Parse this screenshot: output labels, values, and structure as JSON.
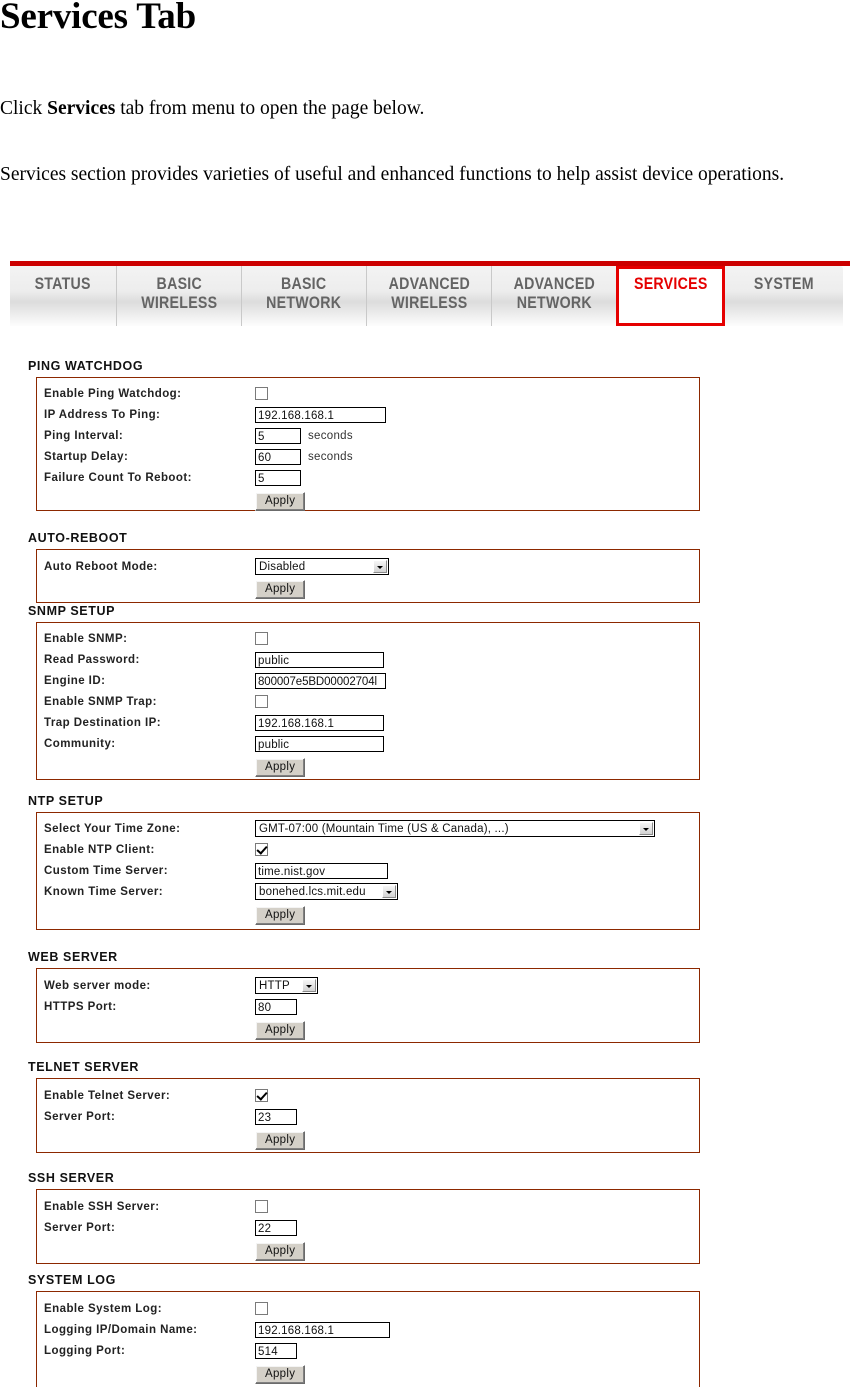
{
  "document": {
    "title": "Services Tab",
    "paragraph_1_pre": "Click ",
    "paragraph_1_bold": "Services",
    "paragraph_1_post": " tab from menu to open the page below.",
    "paragraph_2": "Services section provides varieties of useful and enhanced functions to help assist device operations."
  },
  "colors": {
    "accent_red": "#cc0000",
    "active_tab_red": "#e50000",
    "panel_border": "#8c2800",
    "tab_text": "#646464"
  },
  "navigation": {
    "tabs": [
      {
        "label": "STATUS",
        "active": false
      },
      {
        "label": "BASIC\nWIRELESS",
        "active": false
      },
      {
        "label": "BASIC\nNETWORK",
        "active": false
      },
      {
        "label": "ADVANCED\nWIRELESS",
        "active": false
      },
      {
        "label": "ADVANCED\nNETWORK",
        "active": false
      },
      {
        "label": "SERVICES",
        "active": true
      },
      {
        "label": "SYSTEM",
        "active": false
      }
    ]
  },
  "sections": {
    "ping_watchdog": {
      "title": "PING WATCHDOG",
      "enable_label": "Enable Ping Watchdog:",
      "enable_checked": false,
      "ip_label": "IP Address To Ping:",
      "ip_value": "192.168.168.1",
      "interval_label": "Ping Interval:",
      "interval_value": "5",
      "interval_unit": "seconds",
      "delay_label": "Startup Delay:",
      "delay_value": "60",
      "delay_unit": "seconds",
      "failure_label": "Failure Count To Reboot:",
      "failure_value": "5",
      "apply_label": "Apply"
    },
    "auto_reboot": {
      "title": "AUTO-REBOOT",
      "mode_label": "Auto Reboot Mode:",
      "mode_value": "Disabled",
      "apply_label": "Apply"
    },
    "snmp_setup": {
      "title": "SNMP SETUP",
      "enable_label": "Enable SNMP:",
      "enable_checked": false,
      "read_password_label": "Read Password:",
      "read_password_value": "public",
      "engine_id_label": "Engine ID:",
      "engine_id_value": "800007e5BD00002704l",
      "trap_label": "Enable SNMP Trap:",
      "trap_checked": false,
      "trap_ip_label": "Trap Destination IP:",
      "trap_ip_value": "192.168.168.1",
      "community_label": "Community:",
      "community_value": "public",
      "apply_label": "Apply"
    },
    "ntp_setup": {
      "title": "NTP SETUP",
      "timezone_label": "Select Your Time Zone:",
      "timezone_value": "GMT-07:00 (Mountain Time (US & Canada), ...)",
      "enable_label": "Enable NTP Client:",
      "enable_checked": true,
      "custom_server_label": "Custom Time Server:",
      "custom_server_value": "time.nist.gov",
      "known_server_label": "Known Time Server:",
      "known_server_value": "bonehed.lcs.mit.edu",
      "apply_label": "Apply"
    },
    "web_server": {
      "title": "WEB SERVER",
      "mode_label": "Web server mode:",
      "mode_value": "HTTP",
      "port_label": "HTTPS Port:",
      "port_value": "80",
      "apply_label": "Apply"
    },
    "telnet_server": {
      "title": "TELNET SERVER",
      "enable_label": "Enable Telnet Server:",
      "enable_checked": true,
      "port_label": "Server Port:",
      "port_value": "23",
      "apply_label": "Apply"
    },
    "ssh_server": {
      "title": "SSH SERVER",
      "enable_label": "Enable SSH Server:",
      "enable_checked": false,
      "port_label": "Server Port:",
      "port_value": "22",
      "apply_label": "Apply"
    },
    "system_log": {
      "title": "SYSTEM LOG",
      "enable_label": "Enable System Log:",
      "enable_checked": false,
      "logging_ip_label": "Logging IP/Domain Name:",
      "logging_ip_value": "192.168.168.1",
      "logging_port_label": "Logging Port:",
      "logging_port_value": "514",
      "apply_label": "Apply"
    }
  }
}
